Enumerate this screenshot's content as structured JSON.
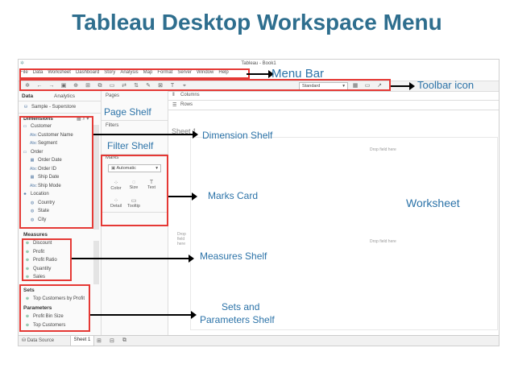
{
  "slide_title": "Tableau Desktop Workspace Menu",
  "window_title": "Tableau - Book1",
  "menu_items": [
    "File",
    "Data",
    "Worksheet",
    "Dashboard",
    "Story",
    "Analysis",
    "Map",
    "Format",
    "Server",
    "Window",
    "Help"
  ],
  "toolbar": {
    "standard_label": "Standard"
  },
  "data_pane": {
    "tab_data": "Data",
    "tab_analytics": "Analytics",
    "source": "Sample - Superstore",
    "dimensions_header": "Dimensions",
    "dimensions": [
      {
        "label": "Customer",
        "icon": "folder-icon",
        "indent": 0
      },
      {
        "label": "Customer Name",
        "icon": "abc-icon",
        "indent": 1
      },
      {
        "label": "Segment",
        "icon": "abc-icon",
        "indent": 1
      },
      {
        "label": "Order",
        "icon": "folder-icon",
        "indent": 0
      },
      {
        "label": "Order Date",
        "icon": "calendar-icon",
        "indent": 1
      },
      {
        "label": "Order ID",
        "icon": "abc-icon",
        "indent": 1
      },
      {
        "label": "Ship Date",
        "icon": "calendar-icon",
        "indent": 1
      },
      {
        "label": "Ship Mode",
        "icon": "abc-icon",
        "indent": 1
      },
      {
        "label": "Location",
        "icon": "hierarchy-icon",
        "indent": 0
      },
      {
        "label": "Country",
        "icon": "globe-icon",
        "indent": 1
      },
      {
        "label": "State",
        "icon": "globe-icon",
        "indent": 1
      },
      {
        "label": "City",
        "icon": "globe-icon",
        "indent": 1
      }
    ],
    "measures_header": "Measures",
    "measures": [
      "Discount",
      "Profit",
      "Profit Ratio",
      "Quantity",
      "Sales"
    ],
    "sets_header": "Sets",
    "sets": [
      "Top Customers by Profit"
    ],
    "parameters_header": "Parameters",
    "parameters": [
      "Profit Bin Size",
      "Top Customers"
    ]
  },
  "shelves": {
    "pages": "Pages",
    "filters": "Filters",
    "marks": "Marks",
    "marks_type": "Automatic",
    "mark_buttons": [
      "Color",
      "Size",
      "Text",
      "Detail",
      "Tooltip"
    ],
    "columns": "Columns",
    "rows": "Rows"
  },
  "worksheet": {
    "sheet_title": "Sheet 1",
    "drop_field_here": "Drop field here",
    "drop_field_here_left": "Drop field here"
  },
  "bottom_tabs": {
    "data_source": "Data Source",
    "sheet1": "Sheet 1"
  },
  "callouts": {
    "menu_bar": "Menu Bar",
    "toolbar_icon": "Toolbar icon",
    "page_shelf": "Page Shelf",
    "dimension_shelf": "Dimension Shelf",
    "filter_shelf": "Filter Shelf",
    "marks_card": "Marks Card",
    "worksheet": "Worksheet",
    "measures_shelf": "Measures Shelf",
    "sets_and_parameters_shelf_line1": "Sets and",
    "sets_and_parameters_shelf_line2": "Parameters Shelf"
  },
  "colors": {
    "title": "#2e6e8e",
    "callout": "#2c73a8",
    "highlight": "#e53935"
  }
}
